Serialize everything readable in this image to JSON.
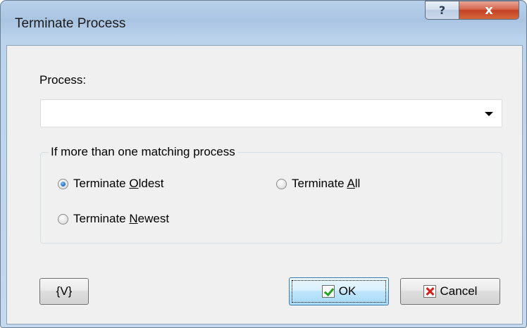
{
  "window": {
    "title": "Terminate Process",
    "help_glyph": "?",
    "close_glyph": "x"
  },
  "form": {
    "process_label": "Process:",
    "process_value": ""
  },
  "group": {
    "legend": "If more than one matching process",
    "options": [
      {
        "pre": "Terminate ",
        "key": "O",
        "post": "ldest",
        "checked": true
      },
      {
        "pre": "Terminate ",
        "key": "A",
        "post": "ll",
        "checked": false
      },
      {
        "pre": "Terminate ",
        "key": "N",
        "post": "ewest",
        "checked": false
      }
    ]
  },
  "buttons": {
    "variables_label": "{V}",
    "ok_label": "OK",
    "cancel_label": "Cancel"
  },
  "icons": {
    "ok": "check-icon",
    "cancel": "x-icon",
    "combo": "chevron-down-icon",
    "help": "help-icon",
    "close": "close-icon"
  }
}
